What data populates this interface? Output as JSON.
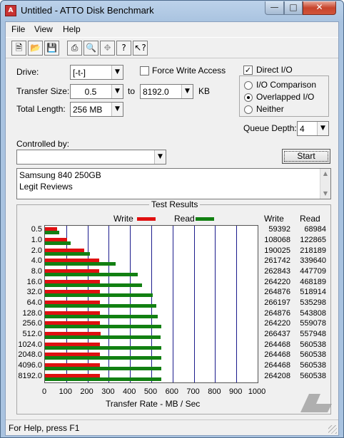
{
  "window": {
    "title": "Untitled - ATTO Disk Benchmark",
    "app_icon_text": "A"
  },
  "menu": [
    "File",
    "View",
    "Help"
  ],
  "toolbar": {
    "icons": [
      "new-icon",
      "open-icon",
      "save-icon",
      "print-icon",
      "print-preview-icon",
      "move-icon",
      "help-icon",
      "context-help-icon"
    ]
  },
  "form": {
    "drive_label": "Drive:",
    "drive_value": "[-t-]",
    "force_write_label": "Force Write Access",
    "force_write_checked": false,
    "direct_io_label": "Direct I/O",
    "direct_io_checked": true,
    "transfer_size_label": "Transfer Size:",
    "transfer_from": "0.5",
    "to_label": "to",
    "transfer_to": "8192.0",
    "kb_label": "KB",
    "total_length_label": "Total Length:",
    "total_length_value": "256 MB",
    "io_options": [
      "I/O Comparison",
      "Overlapped I/O",
      "Neither"
    ],
    "io_selected": "Overlapped I/O",
    "queue_depth_label": "Queue Depth:",
    "queue_depth_value": "4",
    "controlled_by_label": "Controlled by:",
    "controlled_by_value": "",
    "start_label": "Start",
    "description_lines": [
      "Samsung 840 250GB",
      "Legit Reviews"
    ]
  },
  "results": {
    "title": "Test Results",
    "write_legend": "Write",
    "read_legend": "Read",
    "write_col": "Write",
    "read_col": "Read"
  },
  "colors": {
    "write": "#e01010",
    "read": "#128012",
    "grid": "#1b1b8c"
  },
  "chart_data": {
    "type": "bar",
    "title": "Test Results",
    "xlabel": "Transfer Rate - MB / Sec",
    "xlim": [
      0,
      1000
    ],
    "xticks": [
      0,
      100,
      200,
      300,
      400,
      500,
      600,
      700,
      800,
      900,
      1000
    ],
    "categories": [
      "0.5",
      "1.0",
      "2.0",
      "4.0",
      "8.0",
      "16.0",
      "32.0",
      "64.0",
      "128.0",
      "256.0",
      "512.0",
      "1024.0",
      "2048.0",
      "4096.0",
      "8192.0"
    ],
    "series": [
      {
        "name": "Write",
        "values": [
          59392,
          108068,
          190025,
          261742,
          262843,
          264220,
          264876,
          266197,
          264876,
          264220,
          266437,
          264468,
          264468,
          264468,
          264208
        ]
      },
      {
        "name": "Read",
        "values": [
          68984,
          122865,
          218189,
          339640,
          447709,
          468189,
          518914,
          535298,
          543808,
          559078,
          557948,
          560538,
          560538,
          560538,
          560538
        ]
      }
    ]
  },
  "status": {
    "text": "For Help, press F1"
  }
}
